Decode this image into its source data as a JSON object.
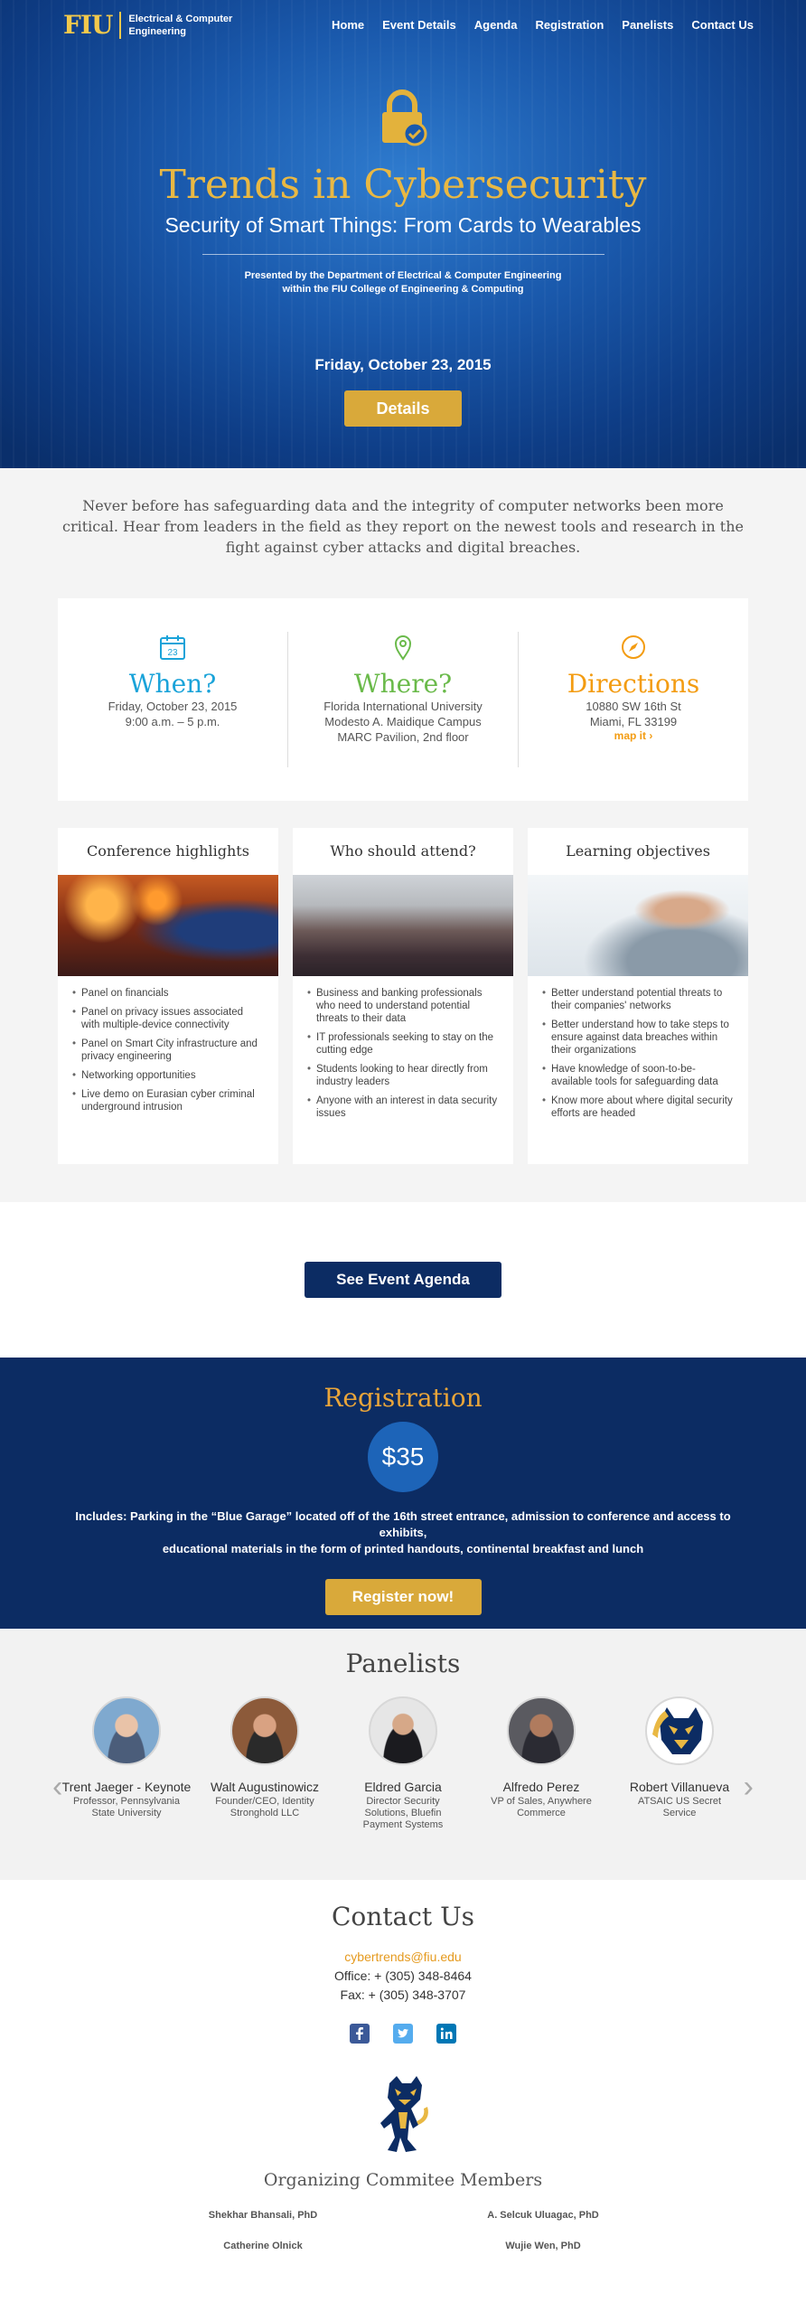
{
  "nav": {
    "logo_mark": "FIU",
    "logo_line1": "Electrical & Computer",
    "logo_line2": "Engineering",
    "links": [
      "Home",
      "Event Details",
      "Agenda",
      "Registration",
      "Panelists",
      "Contact Us"
    ]
  },
  "hero": {
    "title": "Trends in Cybersecurity",
    "subtitle": "Security of Smart Things: From Cards to Wearables",
    "presented_line1": "Presented by the Department of Electrical & Computer Engineering",
    "presented_line2": "within the FIU College of Engineering & Computing",
    "date": "Friday, October 23, 2015",
    "details_button": "Details"
  },
  "intro": "Never before has safeguarding data and the integrity of computer networks been more critical. Hear from leaders in the field as they report on the newest tools and research in the fight against cyber attacks and digital breaches.",
  "info": {
    "when": {
      "icon": "calendar-icon",
      "icon_text": "23",
      "title": "When?",
      "line1": "Friday, October 23, 2015",
      "line2": "9:00 a.m. – 5 p.m.",
      "color": "#1aa3d9"
    },
    "where": {
      "icon": "map-pin-icon",
      "title": "Where?",
      "line1": "Florida International University",
      "line2": "Modesto A. Maidique Campus",
      "line3": "MARC Pavilion, 2nd floor",
      "color": "#6aba4a"
    },
    "directions": {
      "icon": "compass-icon",
      "title": "Directions",
      "line1": "10880 SW 16th St",
      "line2": "Miami, FL 33199",
      "link": "map it ›",
      "color": "#f39c12"
    }
  },
  "cards": [
    {
      "title": "Conference highlights",
      "items": [
        "Panel on financials",
        "Panel on privacy issues associated with multiple-device connectivity",
        "Panel on Smart City infrastructure and privacy engineering",
        "Networking opportunities",
        "Live demo on Eurasian cyber criminal underground intrusion"
      ]
    },
    {
      "title": "Who should attend?",
      "items": [
        "Business and banking professionals who need to understand potential threats to their data",
        "IT professionals seeking to stay on the cutting edge",
        "Students looking to hear directly from industry leaders",
        "Anyone with an interest in data security issues"
      ]
    },
    {
      "title": "Learning objectives",
      "items": [
        "Better understand potential threats to their companies' networks",
        "Better understand how to take steps to ensure against data breaches within their organizations",
        "Have knowledge of soon-to-be-available tools for safeguarding data",
        "Know more about where digital security efforts are headed"
      ]
    }
  ],
  "agenda_button": "See Event Agenda",
  "registration": {
    "title": "Registration",
    "price": "$35",
    "desc_line1": "Includes: Parking in the “Blue Garage” located off of the 16th street entrance, admission to conference and access to exhibits,",
    "desc_line2": "educational materials in the form of printed handouts, continental breakfast and lunch",
    "button": "Register now!"
  },
  "panelists": {
    "title": "Panelists",
    "people": [
      {
        "name": "Trent Jaeger - Keynote",
        "role_line1": "Professor, Pennsylvania",
        "role_line2": "State University",
        "role_line3": ""
      },
      {
        "name": "Walt Augustinowicz",
        "role_line1": "Founder/CEO, Identity",
        "role_line2": "Stronghold LLC",
        "role_line3": ""
      },
      {
        "name": "Eldred Garcia",
        "role_line1": "Director Security",
        "role_line2": "Solutions, Bluefin",
        "role_line3": "Payment Systems"
      },
      {
        "name": "Alfredo Perez",
        "role_line1": "VP of Sales, Anywhere",
        "role_line2": "Commerce",
        "role_line3": ""
      },
      {
        "name": "Robert Villanueva",
        "role_line1": "ATSAIC US Secret Service",
        "role_line2": "",
        "role_line3": ""
      }
    ]
  },
  "contact": {
    "title": "Contact Us",
    "email": "cybertrends@fiu.edu",
    "office": "Office: + (305) 348-8464",
    "fax": "Fax: + (305) 348-3707",
    "committee_title": "Organizing Commitee Members",
    "members": [
      "Shekhar Bhansali, PhD",
      "A. Selcuk Uluagac, PhD",
      "Catherine Olnick",
      "Wujie Wen, PhD"
    ]
  },
  "colors": {
    "navy": "#0c2c63",
    "gold": "#d9a93a",
    "facebook": "#3b5998",
    "twitter": "#55acee",
    "linkedin": "#0077b5"
  }
}
